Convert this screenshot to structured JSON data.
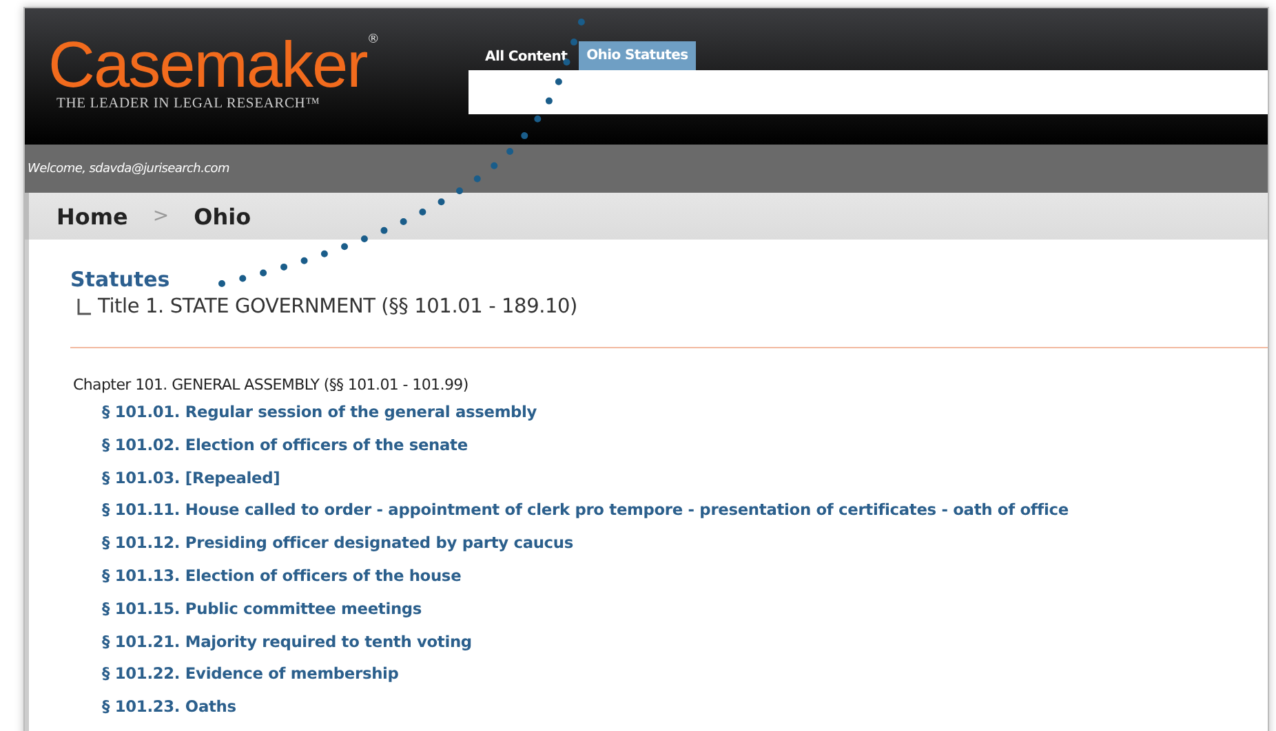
{
  "header": {
    "logo": "Casemaker",
    "logo_mark": "®",
    "tagline": "THE LEADER IN LEGAL RESEARCH™",
    "tabs": [
      {
        "label": "All Content",
        "selected": false
      },
      {
        "label": "Ohio Statutes",
        "selected": true
      }
    ]
  },
  "welcome": "Welcome, sdavda@jurisearch.com",
  "breadcrumb": [
    {
      "label": "Home"
    },
    {
      "label": "Ohio"
    }
  ],
  "breadcrumb_separator": ">",
  "section_title": "Statutes",
  "tree_item": "Title 1. STATE GOVERNMENT (§§ 101.01 - 189.10)",
  "chapter": "Chapter 101. GENERAL ASSEMBLY (§§ 101.01 - 101.99)",
  "sections": [
    "§ 101.01. Regular session of the general assembly",
    "§ 101.02. Election of officers of the senate",
    "§ 101.03. [Repealed]",
    "§ 101.11. House called to order - appointment of clerk pro tempore - presentation of certificates - oath of office",
    "§ 101.12. Presiding officer designated by party caucus",
    "§ 101.13. Election of officers of the house",
    "§ 101.15. Public committee meetings",
    "§ 101.21. Majority required to tenth voting",
    "§ 101.22. Evidence of membership",
    "§ 101.23. Oaths"
  ]
}
